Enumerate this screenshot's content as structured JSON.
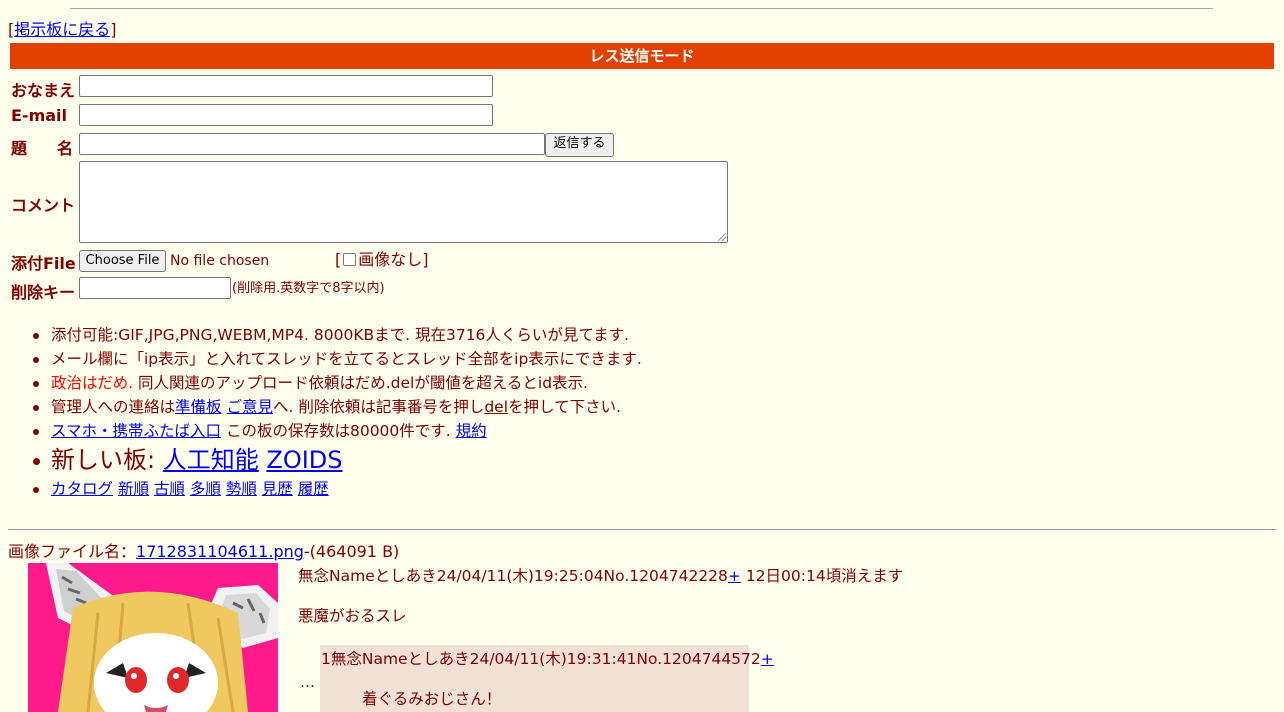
{
  "nav": {
    "bracket_open": "[",
    "return_link": "掲示板に戻る",
    "bracket_close": "]"
  },
  "form": {
    "mode_title": "レス送信モード",
    "name_label": "おなまえ",
    "email_label": "E-mail",
    "subject_label_1": "題",
    "subject_label_2": "名",
    "submit_label": "返信する",
    "comment_label": "コメント",
    "file_label": "添付File",
    "choose_file_label": "Choose File",
    "no_file_text": "No file chosen",
    "no_image_open": "[",
    "no_image_label": "画像なし]",
    "delkey_label": "削除キー",
    "delkey_note": "(削除用.英数字で8字以内)"
  },
  "rules": {
    "line1": "添付可能:GIF,JPG,PNG,WEBM,MP4. 8000KBまで. 現在3716人くらいが見てます.",
    "line2": "メール欄に「ip表示」と入れてスレッドを立てるとスレッド全部をip表示にできます.",
    "line3_red": "政治はだめ.",
    "line3_rest": " 同人関連のアップロード依頼はだめ.delが閾値を超えるとid表示.",
    "line4_a": "管理人への連絡は",
    "line4_link1": "準備板",
    "line4_link2": "ご意見",
    "line4_b": "へ. 削除依頼は記事番号を押し",
    "line4_del": "del",
    "line4_c": "を押して下さい.",
    "line5_link": "スマホ・携帯ふたば入口",
    "line5_text": " この板の保存数は80000件です.",
    "line5_terms": "規約",
    "new_boards_label": "新しい板:",
    "new_board_1": "人工知能",
    "new_board_2": "ZOIDS",
    "sort_links": [
      "カタログ",
      "新順",
      "古順",
      "多順",
      "勢順",
      "見歴",
      "履歴"
    ]
  },
  "thread": {
    "file_label": "画像ファイル名：",
    "file_name": "1712831104611.png",
    "file_size": "-(464091 B)",
    "op_header": "無念Nameとしあき24/04/11(木)19:25:04No.1204742228",
    "op_plus": "+",
    "op_expire": " 12日00:14頃消えます",
    "op_body": "悪魔がおるスレ",
    "ellipsis": "…",
    "reply_header": "1無念Nameとしあき24/04/11(木)19:31:41No.1204744572",
    "reply_plus": "+",
    "reply_body": "着ぐるみおじさん！"
  },
  "colors": {
    "background": "#ffffee",
    "text": "#800000",
    "mode_bar": "#e04000",
    "reply_bg": "#f0e0d6",
    "link": "#0000ee",
    "thumb_bg": "#ff1a8c"
  }
}
